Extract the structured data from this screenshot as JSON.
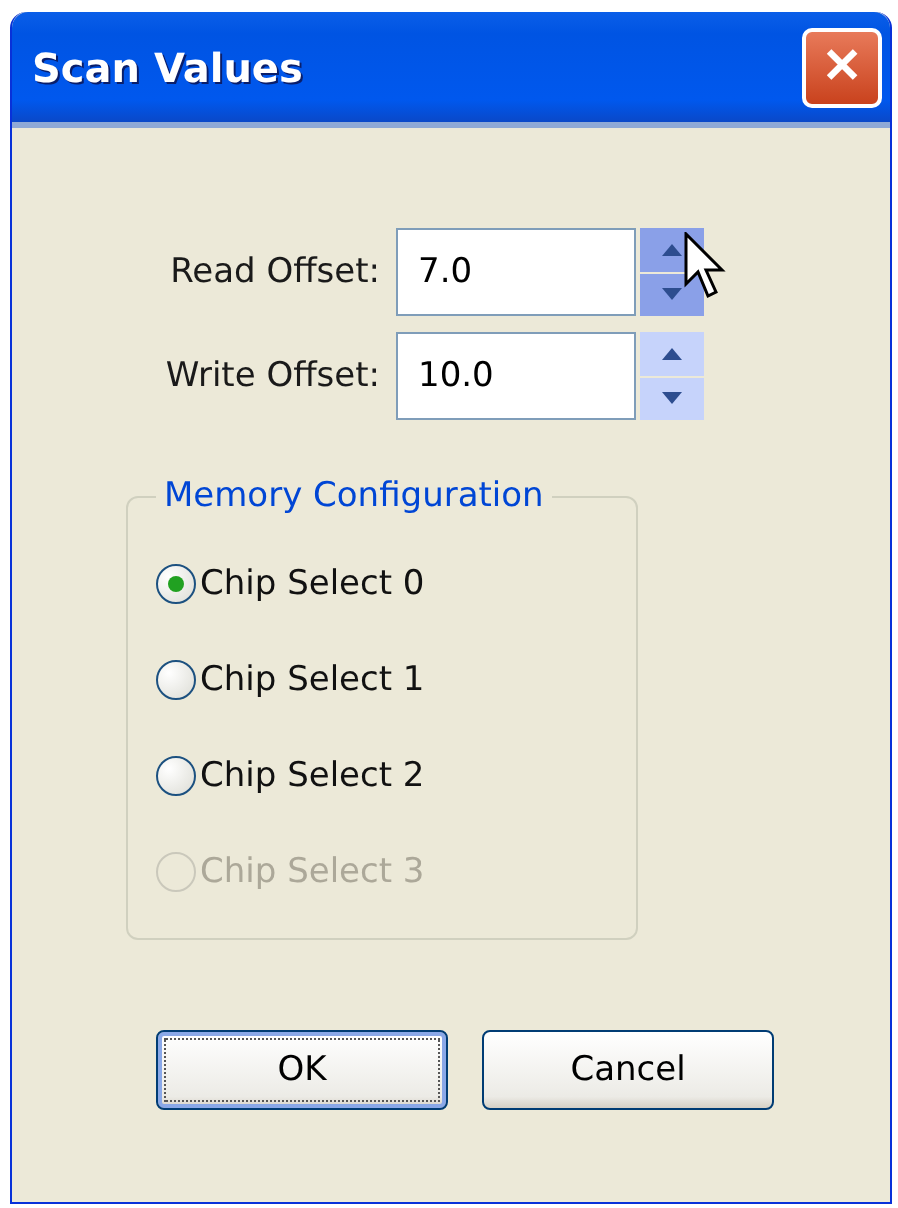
{
  "window": {
    "title": "Scan Values",
    "close": "✕"
  },
  "fields": [
    {
      "label": "Read Offset:",
      "value": "7.0",
      "spinner_hover": true
    },
    {
      "label": "Write Offset:",
      "value": "10.0",
      "spinner_hover": false
    }
  ],
  "group": {
    "title": "Memory Configuration",
    "options": [
      {
        "label": "Chip Select 0",
        "selected": true,
        "disabled": false
      },
      {
        "label": "Chip Select 1",
        "selected": false,
        "disabled": false
      },
      {
        "label": "Chip Select 2",
        "selected": false,
        "disabled": false
      },
      {
        "label": "Chip Select 3",
        "selected": false,
        "disabled": true
      }
    ]
  },
  "buttons": [
    {
      "label": "OK",
      "focused": true
    },
    {
      "label": "Cancel",
      "focused": false
    }
  ]
}
